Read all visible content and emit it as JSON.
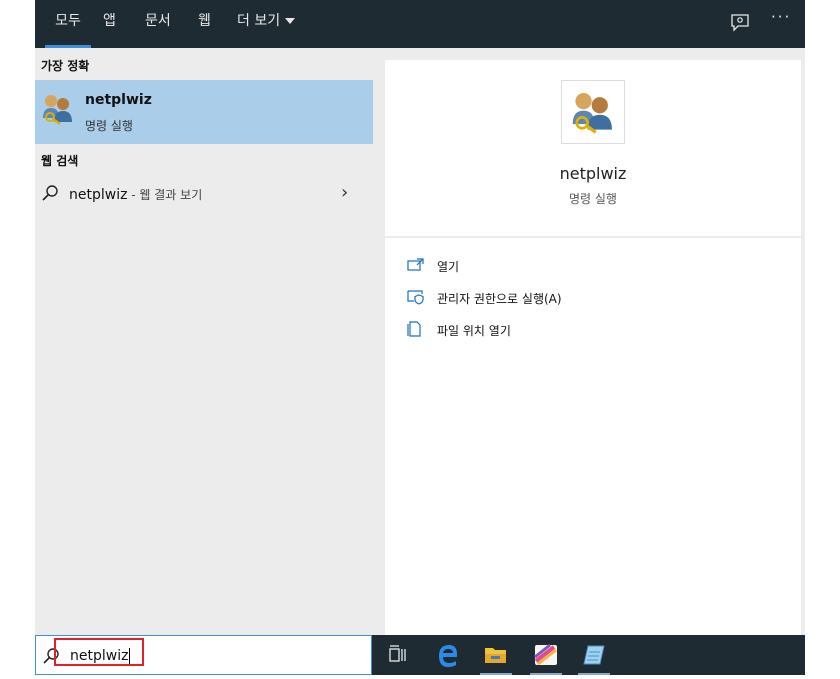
{
  "tabs": [
    {
      "label": "모두",
      "active": true
    },
    {
      "label": "앱",
      "active": false
    },
    {
      "label": "문서",
      "active": false
    },
    {
      "label": "웹",
      "active": false
    },
    {
      "label": "더 보기",
      "active": false
    }
  ],
  "header_icons": [
    "feedback-icon",
    "more-options-icon"
  ],
  "more_symbol": "···",
  "best_match": {
    "heading": "가장 정확",
    "title": "netplwiz",
    "subtitle": "명령 실행",
    "icon": "users-key-icon"
  },
  "web_search": {
    "heading": "웹 검색",
    "query": "netplwiz",
    "suffix": " - 웹 결과 보기",
    "chevron": "›"
  },
  "detail": {
    "title": "netplwiz",
    "subtitle": "명령 실행",
    "actions": [
      {
        "label": "열기",
        "icon": "open-icon"
      },
      {
        "label": "관리자 권한으로 실행(A)",
        "icon": "run-as-admin-icon"
      },
      {
        "label": "파일 위치 열기",
        "icon": "file-location-icon"
      }
    ]
  },
  "search": {
    "value": "netplwiz"
  },
  "taskbar": [
    "task-view-icon",
    "edge-icon",
    "file-explorer-icon",
    "colorful-app-icon",
    "notepad-app-icon"
  ],
  "colors": {
    "accent": "#3d8ee0",
    "highlight": "#aacde9",
    "topbar": "#1f2b33",
    "annotation": "#e0202a"
  }
}
